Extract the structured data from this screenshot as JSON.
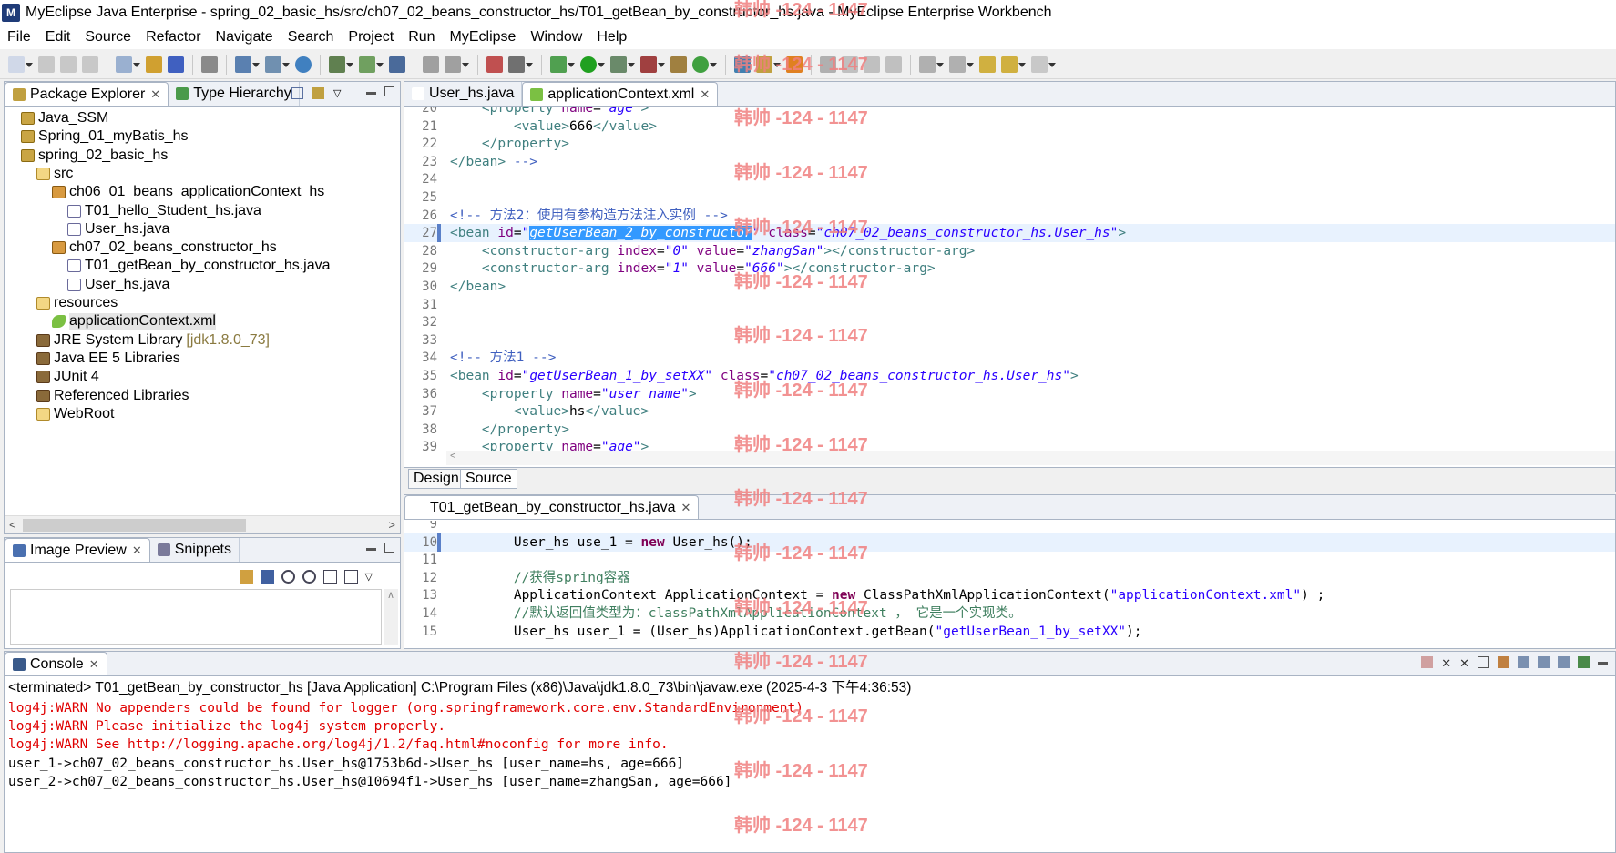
{
  "window": {
    "title": "MyEclipse Java Enterprise - spring_02_basic_hs/src/ch07_02_beans_constructor_hs/T01_getBean_by_constructor_hs.java - MyEclipse Enterprise Workbench"
  },
  "menu": [
    "File",
    "Edit",
    "Source",
    "Refactor",
    "Navigate",
    "Search",
    "Project",
    "Run",
    "MyEclipse",
    "Window",
    "Help"
  ],
  "left_panel": {
    "tabs": [
      {
        "label": "Package Explorer",
        "active": true
      },
      {
        "label": "Type Hierarchy",
        "active": false
      }
    ],
    "tree": [
      {
        "label": "Java_SSM",
        "indent": 0,
        "icon": "proj"
      },
      {
        "label": "Spring_01_myBatis_hs",
        "indent": 0,
        "icon": "proj"
      },
      {
        "label": "spring_02_basic_hs",
        "indent": 0,
        "icon": "proj"
      },
      {
        "label": "src",
        "indent": 1,
        "icon": "src"
      },
      {
        "label": "ch06_01_beans_applicationContext_hs",
        "indent": 2,
        "icon": "pkg"
      },
      {
        "label": "T01_hello_Student_hs.java",
        "indent": 3,
        "icon": "java"
      },
      {
        "label": "User_hs.java",
        "indent": 3,
        "icon": "java"
      },
      {
        "label": "ch07_02_beans_constructor_hs",
        "indent": 2,
        "icon": "pkg"
      },
      {
        "label": "T01_getBean_by_constructor_hs.java",
        "indent": 3,
        "icon": "java"
      },
      {
        "label": "User_hs.java",
        "indent": 3,
        "icon": "java"
      },
      {
        "label": "resources",
        "indent": 1,
        "icon": "src"
      },
      {
        "label": "applicationContext.xml",
        "indent": 2,
        "icon": "xml",
        "selected": true
      },
      {
        "label": "JRE System Library",
        "indent": 1,
        "icon": "lib",
        "suffix": "[jdk1.8.0_73]"
      },
      {
        "label": "Java EE 5 Libraries",
        "indent": 1,
        "icon": "lib"
      },
      {
        "label": "JUnit 4",
        "indent": 1,
        "icon": "lib"
      },
      {
        "label": "Referenced Libraries",
        "indent": 1,
        "icon": "lib"
      },
      {
        "label": "WebRoot",
        "indent": 1,
        "icon": "folder"
      }
    ]
  },
  "preview_panel": {
    "tabs": [
      {
        "label": "Image Preview",
        "active": true
      },
      {
        "label": "Snippets",
        "active": false
      }
    ]
  },
  "xml_editor": {
    "tabs": [
      {
        "label": "User_hs.java",
        "active": false
      },
      {
        "label": "applicationContext.xml",
        "active": true
      }
    ],
    "bottom_tabs": [
      "Design",
      "Source"
    ],
    "lines": [
      {
        "n": "20",
        "html": "    <span class=\"tg\">&lt;property</span> <span class=\"at\">name</span>=<span class=\"av\">\"age\"</span><span class=\"tg\">&gt;</span>"
      },
      {
        "n": "21",
        "html": "        <span class=\"tg\">&lt;value&gt;</span>666<span class=\"tg\">&lt;/value&gt;</span>"
      },
      {
        "n": "22",
        "html": "    <span class=\"tg\">&lt;/property&gt;</span>"
      },
      {
        "n": "23",
        "html": "<span class=\"tg\">&lt;/bean&gt;</span> <span class=\"cm\">--&gt;</span>"
      },
      {
        "n": "24",
        "html": ""
      },
      {
        "n": "25",
        "html": ""
      },
      {
        "n": "26",
        "html": "<span class=\"cm\">&lt;!-- 方法2：使用有参构造方法注入实例 --&gt;</span>"
      },
      {
        "n": "27",
        "html": "<span class=\"tg\">&lt;bean</span> <span class=\"at\">id</span>=<span class=\"av\">\"</span><span class=\"hl\">getUserBean_2_by_constructor</span><span class=\"av\">\"</span> <span class=\"at\">class</span>=<span class=\"av\">\"ch07_02_beans_constructor_hs.User_hs\"</span><span class=\"tg\">&gt;</span>",
        "current": true
      },
      {
        "n": "28",
        "html": "    <span class=\"tg\">&lt;constructor-arg</span> <span class=\"at\">index</span>=<span class=\"av\">\"0\"</span> <span class=\"at\">value</span>=<span class=\"av\">\"zhangSan\"</span><span class=\"tg\">&gt;&lt;/constructor-arg&gt;</span>"
      },
      {
        "n": "29",
        "html": "    <span class=\"tg\">&lt;constructor-arg</span> <span class=\"at\">index</span>=<span class=\"av\">\"1\"</span> <span class=\"at\">value</span>=<span class=\"av\">\"666\"</span><span class=\"tg\">&gt;&lt;/constructor-arg&gt;</span>"
      },
      {
        "n": "30",
        "html": "<span class=\"tg\">&lt;/bean&gt;</span>"
      },
      {
        "n": "31",
        "html": ""
      },
      {
        "n": "32",
        "html": ""
      },
      {
        "n": "33",
        "html": ""
      },
      {
        "n": "34",
        "html": "<span class=\"cm\">&lt;!-- 方法1 --&gt;</span>"
      },
      {
        "n": "35",
        "html": "<span class=\"tg\">&lt;bean</span> <span class=\"at\">id</span>=<span class=\"av\">\"getUserBean_1_by_setXX\"</span> <span class=\"at\">class</span>=<span class=\"av\">\"ch07_02_beans_constructor_hs.User_hs\"</span><span class=\"tg\">&gt;</span>"
      },
      {
        "n": "36",
        "html": "    <span class=\"tg\">&lt;property</span> <span class=\"at\">name</span>=<span class=\"av\">\"user_name\"</span><span class=\"tg\">&gt;</span>"
      },
      {
        "n": "37",
        "html": "        <span class=\"tg\">&lt;value&gt;</span>hs<span class=\"tg\">&lt;/value&gt;</span>"
      },
      {
        "n": "38",
        "html": "    <span class=\"tg\">&lt;/property&gt;</span>"
      },
      {
        "n": "39",
        "html": "    <span class=\"tg\">&lt;property</span> <span class=\"at\">name</span>=<span class=\"av\">\"age\"</span><span class=\"tg\">&gt;</span>"
      }
    ]
  },
  "java_editor": {
    "tabs": [
      {
        "label": "T01_getBean_by_constructor_hs.java",
        "active": true
      }
    ],
    "lines": [
      {
        "n": "9",
        "html": ""
      },
      {
        "n": "10",
        "html": "        User_hs use_1 = <span class=\"kw\">new</span> User_hs();",
        "current": true
      },
      {
        "n": "11",
        "html": ""
      },
      {
        "n": "12",
        "html": "        <span class=\"jc\">//获得spring容器</span>"
      },
      {
        "n": "13",
        "html": "        ApplicationContext ApplicationContext = <span class=\"kw\">new</span> ClassPathXmlApplicationContext(<span class=\"st\">\"applicationContext.xml\"</span>) ;"
      },
      {
        "n": "14",
        "html": "        <span class=\"jc\">//默认返回值类型为：classPathXmlApplicationContext ， 它是一个实现类。</span>"
      },
      {
        "n": "15",
        "html": "        User_hs user_1 = (User_hs)ApplicationContext.getBean(<span class=\"st\">\"getUserBean_1_by_setXX\"</span>);"
      }
    ]
  },
  "console": {
    "tab_label": "Console",
    "header": "<terminated> T01_getBean_by_constructor_hs [Java Application] C:\\Program Files (x86)\\Java\\jdk1.8.0_73\\bin\\javaw.exe (2025-4-3 下午4:36:53)",
    "lines": [
      {
        "text": "log4j:WARN No appenders could be found for logger (org.springframework.core.env.StandardEnvironment).",
        "err": true
      },
      {
        "text": "log4j:WARN Please initialize the log4j system properly.",
        "err": true
      },
      {
        "text": "log4j:WARN See http://logging.apache.org/log4j/1.2/faq.html#noconfig for more info.",
        "err": true
      },
      {
        "text": "user_1->ch07_02_beans_constructor_hs.User_hs@1753b6d->User_hs [user_name=hs, age=666]",
        "err": false
      },
      {
        "text": "user_2->ch07_02_beans_constructor_hs.User_hs@10694f1->User_hs [user_name=zhangSan, age=666]",
        "err": false
      }
    ]
  },
  "watermark": "韩帅 -124 - 1147"
}
